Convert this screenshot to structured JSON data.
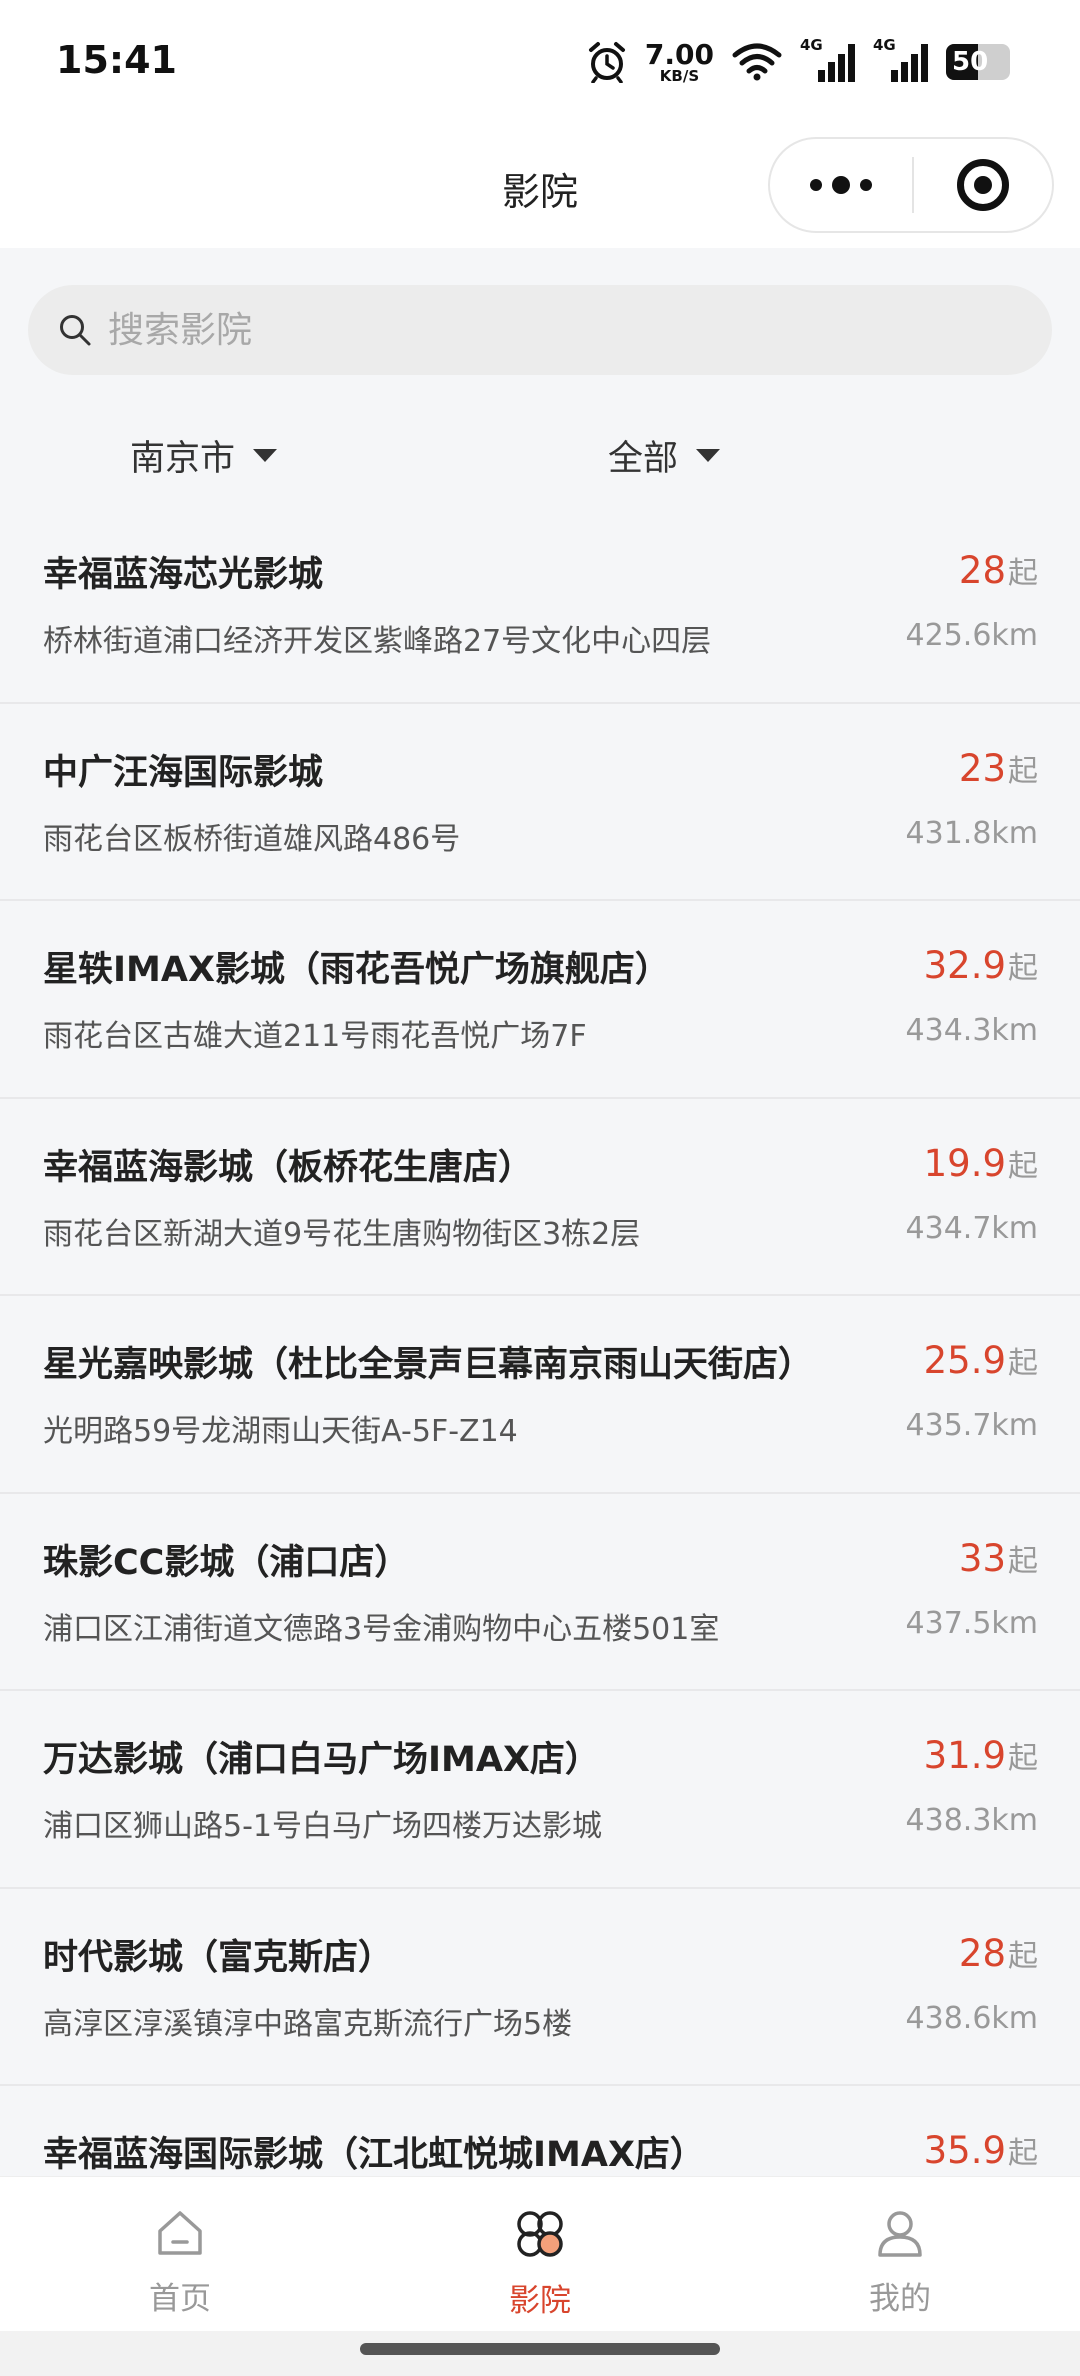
{
  "status_bar": {
    "time": "15:41",
    "net_speed_value": "7.00",
    "net_speed_unit": "KB/S",
    "signal_1_label": "4G",
    "signal_2_label": "4G",
    "battery_percent": "50"
  },
  "nav": {
    "title": "影院"
  },
  "search": {
    "placeholder": "搜索影院"
  },
  "filters": {
    "city": "南京市",
    "type": "全部"
  },
  "price_suffix": "起",
  "cinemas": [
    {
      "name": "幸福蓝海芯光影城",
      "address": "桥林街道浦口经济开发区紫峰路27号文化中心四层",
      "price": "28",
      "distance": "425.6km"
    },
    {
      "name": "中广汪海国际影城",
      "address": "雨花台区板桥街道雄风路486号",
      "price": "23",
      "distance": "431.8km"
    },
    {
      "name": "星轶IMAX影城（雨花吾悦广场旗舰店）",
      "address": "雨花台区古雄大道211号雨花吾悦广场7F",
      "price": "32.9",
      "distance": "434.3km"
    },
    {
      "name": "幸福蓝海影城（板桥花生唐店）",
      "address": "雨花台区新湖大道9号花生唐购物街区3栋2层",
      "price": "19.9",
      "distance": "434.7km"
    },
    {
      "name": "星光嘉映影城（杜比全景声巨幕南京雨山天街店）",
      "address": "光明路59号龙湖雨山天街A-5F-Z14",
      "price": "25.9",
      "distance": "435.7km"
    },
    {
      "name": "珠影CC影城（浦口店）",
      "address": "浦口区江浦街道文德路3号金浦购物中心五楼501室",
      "price": "33",
      "distance": "437.5km"
    },
    {
      "name": "万达影城（浦口白马广场IMAX店）",
      "address": "浦口区狮山路5-1号白马广场四楼万达影城",
      "price": "31.9",
      "distance": "438.3km"
    },
    {
      "name": "时代影城（富克斯店）",
      "address": "高淳区淳溪镇淳中路富克斯流行广场5楼",
      "price": "28",
      "distance": "438.6km"
    },
    {
      "name": "幸福蓝海国际影城（江北虹悦城IMAX店）",
      "address": "",
      "price": "35.9",
      "distance": ""
    }
  ],
  "tabs": [
    {
      "label": "首页",
      "icon": "home-icon",
      "active": false
    },
    {
      "label": "影院",
      "icon": "cinema-icon",
      "active": true
    },
    {
      "label": "我的",
      "icon": "user-icon",
      "active": false
    }
  ],
  "colors": {
    "accent": "#d8452d",
    "muted": "#999999",
    "background": "#f5f6f8"
  }
}
